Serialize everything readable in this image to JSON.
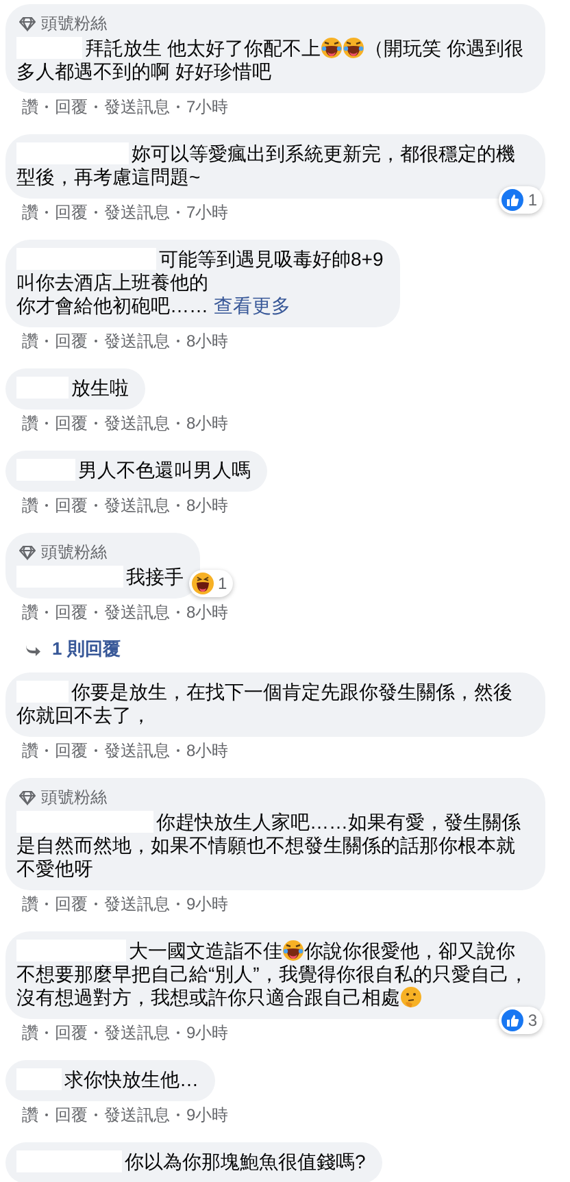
{
  "items": [
    {
      "kind": "comment",
      "badge": "頭號粉絲",
      "redacted": true,
      "body": [
        {
          "kind": "text",
          "text": "拜託放生 他太好了你配不上"
        },
        {
          "kind": "laugh"
        },
        {
          "kind": "laugh"
        },
        {
          "kind": "text",
          "text": "（開玩笑 你遇到很多人都遇不到的啊 好好珍惜吧"
        }
      ],
      "actions": [
        "讚",
        "回覆",
        "發送訊息"
      ],
      "time": "7小時"
    },
    {
      "kind": "comment",
      "redacted": true,
      "body": [
        {
          "kind": "text",
          "text": "妳可以等愛瘋出到系統更新完，都很穩定的機型後，再考慮這問題~"
        }
      ],
      "reaction": {
        "kind": "like",
        "count": "1"
      },
      "actions": [
        "讚",
        "回覆",
        "發送訊息"
      ],
      "time": "7小時"
    },
    {
      "kind": "comment",
      "redacted": true,
      "body": [
        {
          "kind": "text",
          "text": "可能等到遇見吸毒好帥8+9"
        },
        {
          "kind": "break"
        },
        {
          "kind": "text",
          "text": "叫你去酒店上班養他的"
        },
        {
          "kind": "break"
        },
        {
          "kind": "text",
          "text": "你才會給他初砲吧……"
        }
      ],
      "see_more": "查看更多",
      "actions": [
        "讚",
        "回覆",
        "發送訊息"
      ],
      "time": "8小時"
    },
    {
      "kind": "comment",
      "redacted": true,
      "body": [
        {
          "kind": "text",
          "text": "放生啦"
        }
      ],
      "actions": [
        "讚",
        "回覆",
        "發送訊息"
      ],
      "time": "8小時"
    },
    {
      "kind": "comment",
      "redacted": true,
      "body": [
        {
          "kind": "text",
          "text": "男人不色還叫男人嗎"
        }
      ],
      "actions": [
        "讚",
        "回覆",
        "發送訊息"
      ],
      "time": "8小時"
    },
    {
      "kind": "comment",
      "badge": "頭號粉絲",
      "redacted": true,
      "body": [
        {
          "kind": "text",
          "text": "我接手"
        }
      ],
      "reaction": {
        "kind": "haha",
        "count": "1"
      },
      "actions": [
        "讚",
        "回覆",
        "發送訊息"
      ],
      "time": "8小時"
    },
    {
      "kind": "replies",
      "label": "1 則回覆"
    },
    {
      "kind": "comment",
      "redacted": true,
      "body": [
        {
          "kind": "text",
          "text": "你要是放生，在找下一個肯定先跟你發生關係，然後你就回不去了，"
        }
      ],
      "actions": [
        "讚",
        "回覆",
        "發送訊息"
      ],
      "time": "8小時"
    },
    {
      "kind": "comment",
      "badge": "頭號粉絲",
      "redacted": true,
      "body": [
        {
          "kind": "text",
          "text": "你趕快放生人家吧……如果有愛，發生關係是自然而然地，如果不情願也不想發生關係的話那你根本就不愛他呀"
        }
      ],
      "actions": [
        "讚",
        "回覆",
        "發送訊息"
      ],
      "time": "9小時"
    },
    {
      "kind": "comment",
      "redacted": true,
      "body": [
        {
          "kind": "text",
          "text": "大一國文造詣不佳"
        },
        {
          "kind": "laugh"
        },
        {
          "kind": "text",
          "text": "你說你很愛他，卻又說你不想要那麼早把自己給“別人”，我覺得你很自私的只愛自己，沒有想過對方，我想或許你只適合跟自己相處"
        },
        {
          "kind": "think"
        }
      ],
      "reaction": {
        "kind": "like",
        "count": "3"
      },
      "actions": [
        "讚",
        "回覆",
        "發送訊息"
      ],
      "time": "9小時"
    },
    {
      "kind": "comment",
      "redacted": true,
      "body": [
        {
          "kind": "text",
          "text": "求你快放生他…"
        }
      ],
      "actions": [
        "讚",
        "回覆",
        "發送訊息"
      ],
      "time": "9小時"
    },
    {
      "kind": "comment",
      "redacted": true,
      "body": [
        {
          "kind": "text",
          "text": "你以為你那塊鮑魚很值錢嗎?"
        }
      ]
    }
  ]
}
